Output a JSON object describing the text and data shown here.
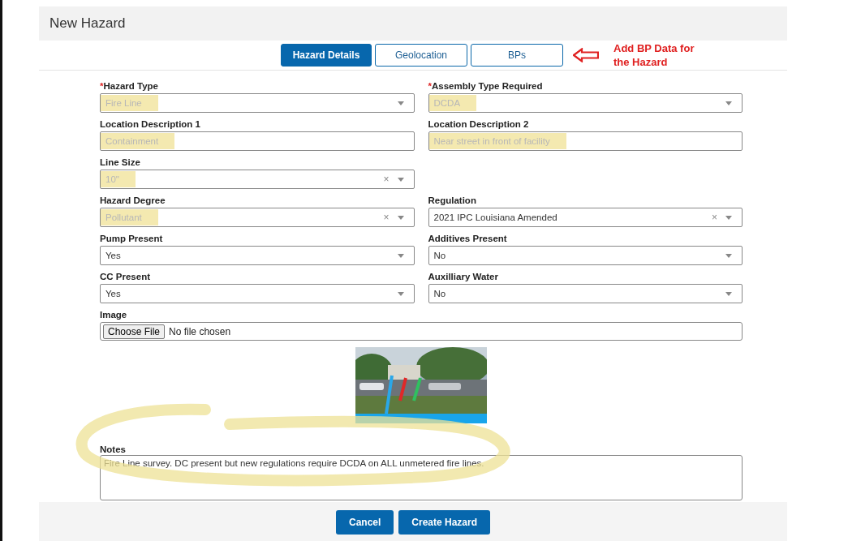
{
  "title": "New Hazard",
  "tabs": [
    {
      "label": "Hazard Details",
      "selected": true
    },
    {
      "label": "Geolocation",
      "selected": false
    },
    {
      "label": "BPs",
      "selected": false
    }
  ],
  "callout": "Add BP Data for the Hazard",
  "rows": [
    [
      {
        "label": "Hazard Type",
        "required_mark": "*",
        "kind": "select",
        "placeholder": "Fire Line",
        "highlighted": true
      },
      {
        "label": "Assembly Type Required",
        "required_mark": "*",
        "kind": "select",
        "placeholder": "DCDA",
        "highlighted": true
      }
    ],
    [
      {
        "label": "Location Description 1",
        "kind": "text",
        "placeholder": "Containment",
        "highlighted": true
      },
      {
        "label": "Location Description 2",
        "kind": "text",
        "placeholder": "Near street in front of facility",
        "highlighted": true
      }
    ],
    [
      {
        "label": "Line Size",
        "kind": "select",
        "placeholder": "10\"",
        "clear": "×",
        "highlighted": true
      }
    ],
    [
      {
        "label": "Hazard Degree",
        "kind": "select",
        "placeholder": "Pollutant",
        "clear": "×",
        "highlighted": true
      },
      {
        "label": "Regulation",
        "kind": "select",
        "value": "2021 IPC Louisiana Amended",
        "clear": "×",
        "highlighted": false
      }
    ],
    [
      {
        "label": "Pump Present",
        "kind": "select",
        "value": "Yes",
        "highlighted": false
      },
      {
        "label": "Additives Present",
        "kind": "select",
        "value": "No",
        "highlighted": false
      }
    ],
    [
      {
        "label": "CC Present",
        "kind": "select",
        "value": "Yes",
        "highlighted": false
      },
      {
        "label": "Auxilliary Water",
        "kind": "select",
        "value": "No",
        "highlighted": false
      }
    ]
  ],
  "image": {
    "label": "Image",
    "button": "Choose File",
    "status": "No file chosen"
  },
  "notes": {
    "label": "Notes",
    "value": "Fire Line survey.  DC present but new regulations require DCDA on ALL unmetered fire lines.",
    "circled": true
  },
  "buttons": [
    "Cancel",
    "Create Hazard"
  ]
}
